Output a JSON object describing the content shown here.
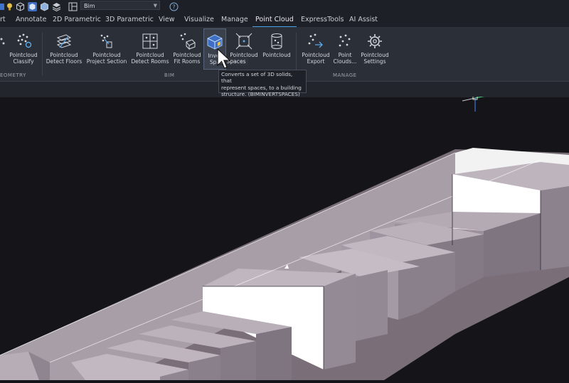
{
  "quick_access": {
    "icons": [
      "tree-icon",
      "lightbulb-icon",
      "cube-icon",
      "cube-solid-icon",
      "cube-wire-icon",
      "stack-icon",
      "layout-icon",
      "help-icon"
    ],
    "workspace": "Bim"
  },
  "tabs": [
    {
      "label": "rt"
    },
    {
      "label": "Annotate"
    },
    {
      "label": "2D Parametric"
    },
    {
      "label": "3D Parametric"
    },
    {
      "label": "View"
    },
    {
      "label": "Visualize"
    },
    {
      "label": "Manage"
    },
    {
      "label": "Point Cloud",
      "active": true
    },
    {
      "label": "ExpressTools"
    },
    {
      "label": "AI Assist"
    }
  ],
  "ribbon": {
    "buttons": [
      {
        "id": "pc-classify",
        "line1": "Pointcloud",
        "line2": "Classify"
      },
      {
        "id": "pc-detect-floors",
        "line1": "Pointcloud",
        "line2": "Detect Floors"
      },
      {
        "id": "pc-project-section",
        "line1": "Pointcloud",
        "line2": "Project Section"
      },
      {
        "id": "pc-detect-rooms",
        "line1": "Pointcloud",
        "line2": "Detect Rooms"
      },
      {
        "id": "pc-fit-rooms",
        "line1": "Pointcloud",
        "line2": "Fit Rooms"
      },
      {
        "id": "invert-spaces",
        "line1": "Inver",
        "line2": "Spa"
      },
      {
        "id": "pc-7",
        "line1": "Pointcloud",
        "line2": ""
      },
      {
        "id": "pc-8",
        "line1": "Pointcloud",
        "line2": ""
      },
      {
        "id": "pc-export",
        "line1": "Pointcloud",
        "line2": "Export"
      },
      {
        "id": "point-clouds",
        "line1": "Point",
        "line2": "Clouds..."
      },
      {
        "id": "pc-settings",
        "line1": "Pointcloud",
        "line2": "Settings"
      }
    ],
    "groups": [
      {
        "label": "EOMETRY"
      },
      {
        "label": "BIM"
      },
      {
        "label": "MANAGE"
      }
    ]
  },
  "tooltip": {
    "title": "rt Spaces",
    "description_lines": [
      "Converts a set of 3D solids, that",
      "represent spaces, to a building",
      "structure. (BIMINVERTSPACES)"
    ]
  },
  "colors": {
    "accent": "#4aa3e8",
    "ribbon_bg": "#2b2f37",
    "tab_bg": "#1d2027",
    "viewport_bg": "#151519"
  }
}
